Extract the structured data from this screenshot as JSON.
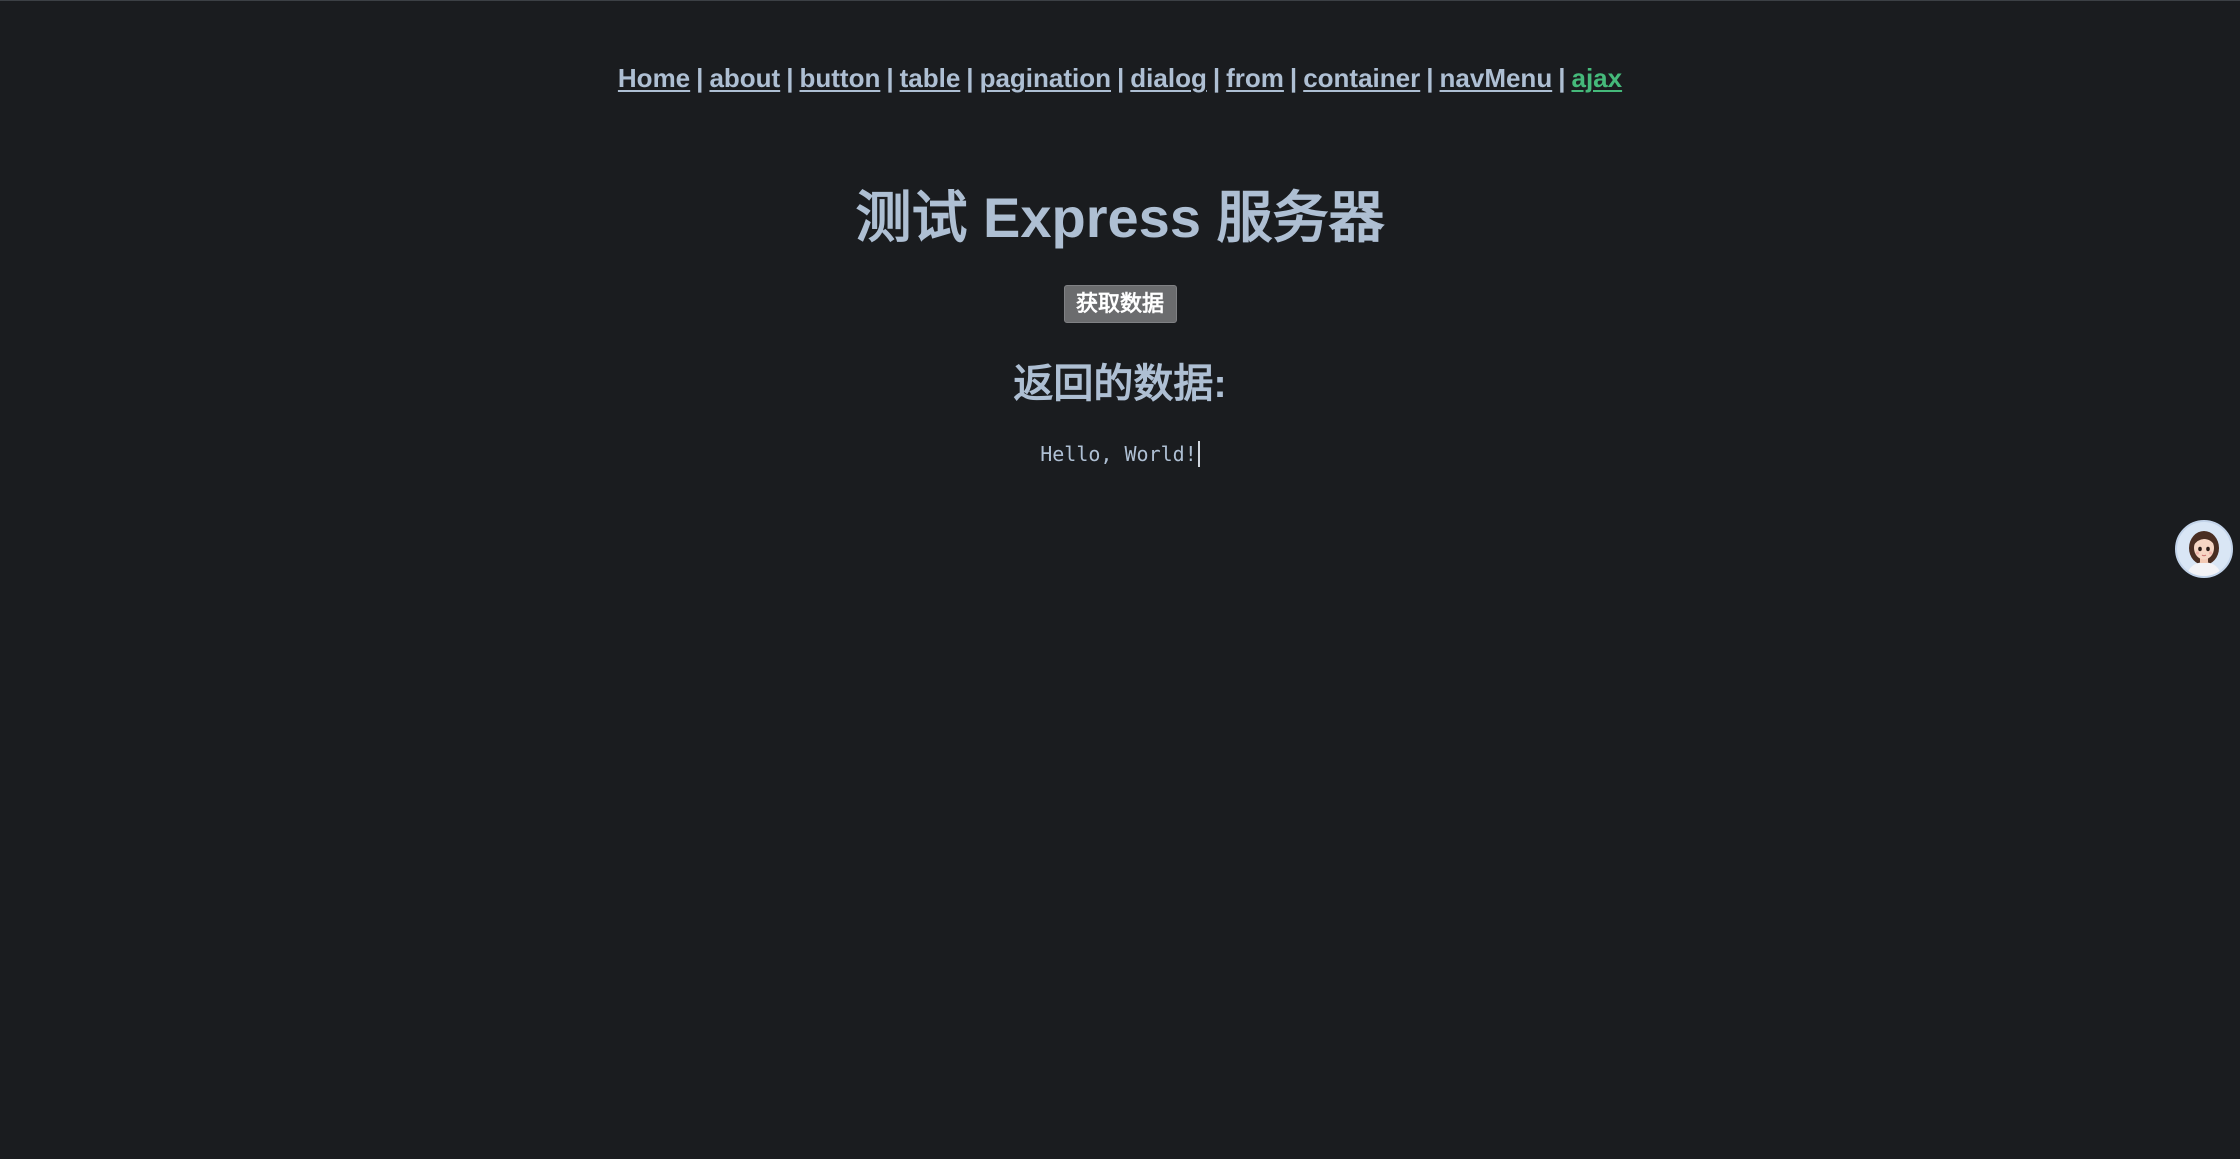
{
  "nav": {
    "items": [
      {
        "label": "Home",
        "active": false
      },
      {
        "label": "about",
        "active": false
      },
      {
        "label": "button",
        "active": false
      },
      {
        "label": "table",
        "active": false
      },
      {
        "label": "pagination",
        "active": false
      },
      {
        "label": "dialog",
        "active": false
      },
      {
        "label": "from",
        "active": false
      },
      {
        "label": "container",
        "active": false
      },
      {
        "label": "navMenu",
        "active": false
      },
      {
        "label": "ajax",
        "active": true
      }
    ],
    "separator": "|"
  },
  "main": {
    "title": "测试 Express 服务器",
    "fetch_button_label": "获取数据",
    "result_heading": "返回的数据:",
    "result_text": "Hello, World!"
  },
  "assistant": {
    "icon": "avatar-icon"
  },
  "colors": {
    "background": "#1a1c1f",
    "text": "#aebfd3",
    "active_link": "#45b97a",
    "button_bg": "#6b6c6e"
  }
}
